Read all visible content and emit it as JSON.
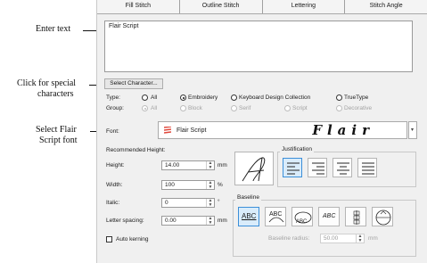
{
  "annotations": {
    "enter_text": "Enter text",
    "click_special_line1": "Click for special",
    "click_special_line2": "characters",
    "select_font_line1": "Select Flair",
    "select_font_line2": "Script font"
  },
  "tabs": [
    "Fill Stitch",
    "Outline Stitch",
    "Lettering",
    "Stitch Angle"
  ],
  "text_input": {
    "value": "Flair Script"
  },
  "select_character_button": "Select Character...",
  "type": {
    "label": "Type:",
    "options": [
      "All",
      "Embroidery",
      "Keyboard Design Collection",
      "TrueType"
    ],
    "selected": "Embroidery"
  },
  "group": {
    "label": "Group:",
    "options": [
      "All",
      "Block",
      "Serif",
      "Script",
      "Decorative"
    ],
    "selected": "All"
  },
  "font": {
    "label": "Font:",
    "value": "Flair Script",
    "preview": "Flair",
    "icon": "embroidery-font-icon",
    "icon_color": "#e0463a"
  },
  "recommended_height_label": "Recommended Height:",
  "height": {
    "label": "Height:",
    "value": "14.00",
    "unit": "mm"
  },
  "width": {
    "label": "Width:",
    "value": "100",
    "unit": "%"
  },
  "italic": {
    "label": "Italic:",
    "value": "0",
    "unit": "°"
  },
  "letter_spacing": {
    "label": "Letter spacing:",
    "value": "0.00",
    "unit": "mm"
  },
  "auto_kerning_label": "Auto kerning",
  "justification_label": "Justification",
  "baseline_label": "Baseline",
  "baseline_radius": {
    "label": "Baseline radius:",
    "value": "50.00",
    "unit": "mm"
  },
  "baseline_icon_text": "ABC",
  "accent_color": "#3c8fd9"
}
